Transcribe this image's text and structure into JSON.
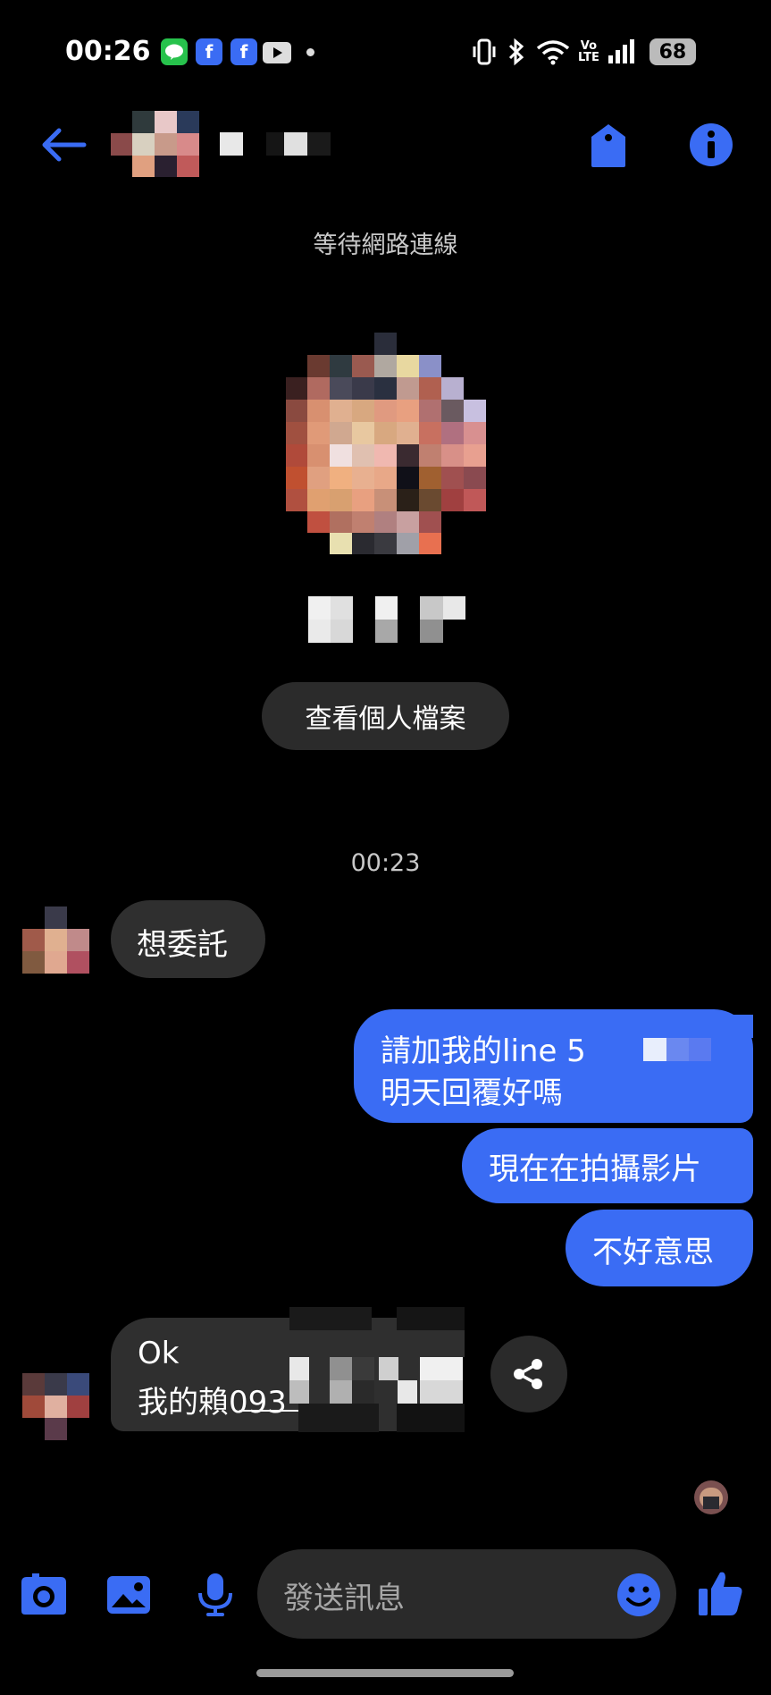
{
  "status_bar": {
    "time": "00:26",
    "battery": "68",
    "volte_label": "Vo\nLTE",
    "app_icons": [
      "line-icon",
      "facebook-icon",
      "facebook-icon",
      "youtube-icon"
    ]
  },
  "header": {
    "back_icon": "arrow-left-icon",
    "tag_icon": "tag-icon",
    "info_icon": "info-icon",
    "accent": "#3a6cf4"
  },
  "banner": {
    "waiting_text": "等待網路連線"
  },
  "profile": {
    "view_profile_label": "查看個人檔案"
  },
  "conversation": {
    "timestamp": "00:23",
    "messages": [
      {
        "from": "them",
        "lines": [
          "想委託"
        ]
      },
      {
        "from": "me",
        "lines": [
          "請加我的line 5",
          "明天回覆好嗎"
        ]
      },
      {
        "from": "me",
        "lines": [
          "現在在拍攝影片"
        ]
      },
      {
        "from": "me",
        "lines": [
          "不好意思"
        ]
      },
      {
        "from": "them",
        "lines": [
          "Ok",
          "我的賴093",
          "5"
        ]
      }
    ]
  },
  "composer": {
    "placeholder": "發送訊息",
    "icons": [
      "camera-icon",
      "image-icon",
      "microphone-icon",
      "emoji-icon",
      "thumbs-up-icon"
    ]
  },
  "colors": {
    "background": "#000000",
    "incoming_bubble": "#2f2f2f",
    "outgoing_bubble": "#3a6cf4",
    "icon_blue": "#3a6cf4"
  }
}
